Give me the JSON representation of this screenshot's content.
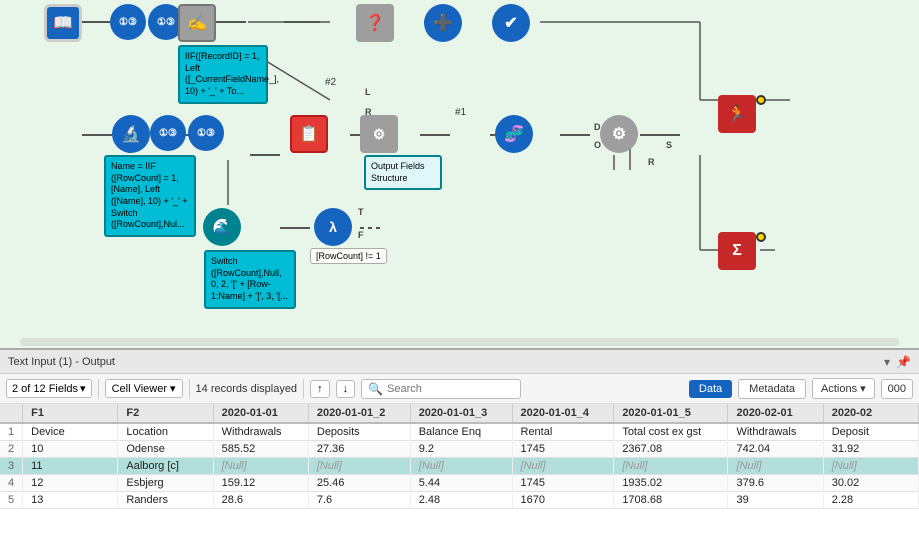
{
  "title_bar": {
    "label": "Text Input (1) - Output",
    "collapse_icon": "▾",
    "pin_icon": "📌"
  },
  "toolbar": {
    "fields_label": "2 of 12 Fields",
    "cell_viewer_label": "Cell Viewer",
    "records_label": "14 records displayed",
    "up_arrow": "↑",
    "down_arrow": "↓",
    "search_placeholder": "Search",
    "btn_data": "Data",
    "btn_metadata": "Metadata",
    "btn_actions": "Actions",
    "btn_000": "000"
  },
  "table": {
    "headers": [
      "",
      "F1",
      "F2",
      "2020-01-01",
      "2020-01-01_2",
      "2020-01-01_3",
      "2020-01-01_4",
      "2020-01-01_5",
      "2020-02-01",
      "2020-02"
    ],
    "rows": [
      {
        "num": "1",
        "f1": "Device",
        "f2": "Location",
        "c1": "Withdrawals",
        "c2": "Deposits",
        "c3": "Balance Enq",
        "c4": "Rental",
        "c5": "Total cost ex gst",
        "c6": "Withdrawals",
        "c7": "Deposit",
        "highlight": false
      },
      {
        "num": "2",
        "f1": "10",
        "f2": "Odense",
        "c1": "585.52",
        "c2": "27.36",
        "c3": "9.2",
        "c4": "1745",
        "c5": "2367.08",
        "c6": "742.04",
        "c7": "31.92",
        "highlight": false
      },
      {
        "num": "3",
        "f1": "11",
        "f2": "Aalborg [c]",
        "c1": "[Null]",
        "c2": "[Null]",
        "c3": "[Null]",
        "c4": "[Null]",
        "c5": "[Null]",
        "c6": "[Null]",
        "c7": "[Null]",
        "highlight": true
      },
      {
        "num": "4",
        "f1": "12",
        "f2": "Esbjerg",
        "c1": "159.12",
        "c2": "25.46",
        "c3": "5.44",
        "c4": "1745",
        "c5": "1935.02",
        "c6": "379.6",
        "c7": "30.02",
        "highlight": false
      },
      {
        "num": "5",
        "f1": "13",
        "f2": "Randers",
        "c1": "28.6",
        "c2": "7.6",
        "c3": "2.48",
        "c4": "1670",
        "c5": "1708.68",
        "c6": "39",
        "c7": "2.28",
        "highlight": false
      }
    ]
  },
  "nodes": {
    "tooltip1": "IIF([RecordID] = 1, Left ([_CurrentFieldName_], 10) + '_' + To...",
    "tooltip2": "Name = IIF ([RowCount] = 1, [Name], Left ([Name], 10) + '_' + Switch ([RowCount],Nul...",
    "tooltip3": "Switch ([RowCount],Null, 0, 2, '[' + [Row-1:Name] + ']', 3, '[...",
    "tooltip4": "Output Fields Structure",
    "label_r": "R",
    "label_l": "L",
    "label_t": "T",
    "label_f": "F",
    "label_2": "#2",
    "label_1": "#1",
    "rowcount_label": "[RowCount] != 1"
  }
}
